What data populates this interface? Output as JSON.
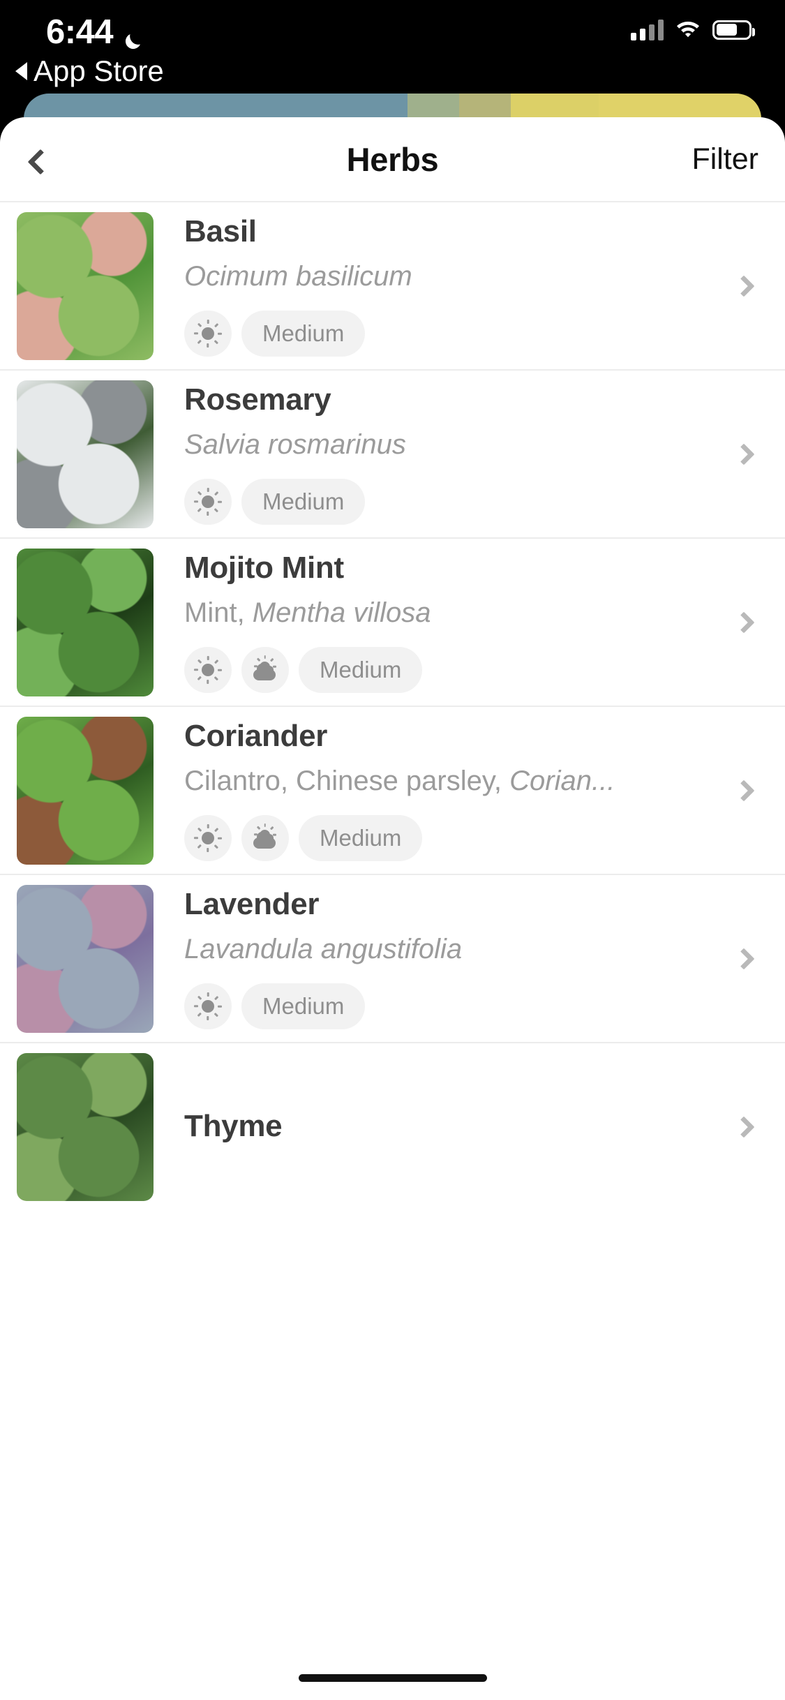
{
  "status_bar": {
    "time": "6:44",
    "dnd_icon": "moon-icon",
    "return_label": "App Store",
    "cellular_icon": "cellular-signal-icon",
    "wifi_icon": "wifi-icon",
    "battery_icon": "battery-icon"
  },
  "card_peek": {
    "colors": [
      "#6d94a5",
      "#9fb08c",
      "#b5b479",
      "#dcd067",
      "#e0d268"
    ]
  },
  "navbar": {
    "back_icon": "chevron-left-icon",
    "title": "Herbs",
    "filter_label": "Filter"
  },
  "icons": {
    "sun": "sun-icon",
    "partial_sun": "sun-behind-cloud-icon",
    "chevron": "chevron-right-icon"
  },
  "list": {
    "rows": [
      {
        "name": "Basil",
        "subtitle_plain": "",
        "subtitle_italic": "Ocimum basilicum",
        "light_icons": [
          "sun-icon"
        ],
        "water_label": "Medium",
        "thumb_colors": [
          "#8fbc63",
          "#4f9338",
          "#dba898"
        ]
      },
      {
        "name": "Rosemary",
        "subtitle_plain": "",
        "subtitle_italic": "Salvia rosmarinus",
        "light_icons": [
          "sun-icon"
        ],
        "water_label": "Medium",
        "thumb_colors": [
          "#e6e9ea",
          "#3f5c35",
          "#8b9093"
        ]
      },
      {
        "name": "Mojito Mint",
        "subtitle_plain": "Mint, ",
        "subtitle_italic": "Mentha villosa",
        "light_icons": [
          "sun-icon",
          "sun-behind-cloud-icon"
        ],
        "water_label": "Medium",
        "thumb_colors": [
          "#4f8a3a",
          "#1e3d17",
          "#73b158"
        ]
      },
      {
        "name": "Coriander",
        "subtitle_plain": "Cilantro, Chinese parsley, ",
        "subtitle_italic": "Corian...",
        "light_icons": [
          "sun-icon",
          "sun-behind-cloud-icon"
        ],
        "water_label": "Medium",
        "thumb_colors": [
          "#6fae4a",
          "#2f5d22",
          "#8d5a3a"
        ]
      },
      {
        "name": "Lavender",
        "subtitle_plain": "",
        "subtitle_italic": "Lavandula angustifolia",
        "light_icons": [
          "sun-icon"
        ],
        "water_label": "Medium",
        "thumb_colors": [
          "#9aa7b8",
          "#7d6f9e",
          "#b88fa8"
        ]
      },
      {
        "name": "Thyme",
        "subtitle_plain": "",
        "subtitle_italic": "",
        "light_icons": [],
        "water_label": "",
        "thumb_colors": [
          "#5d8a47",
          "#2a4a22",
          "#7fa85f"
        ]
      }
    ]
  }
}
